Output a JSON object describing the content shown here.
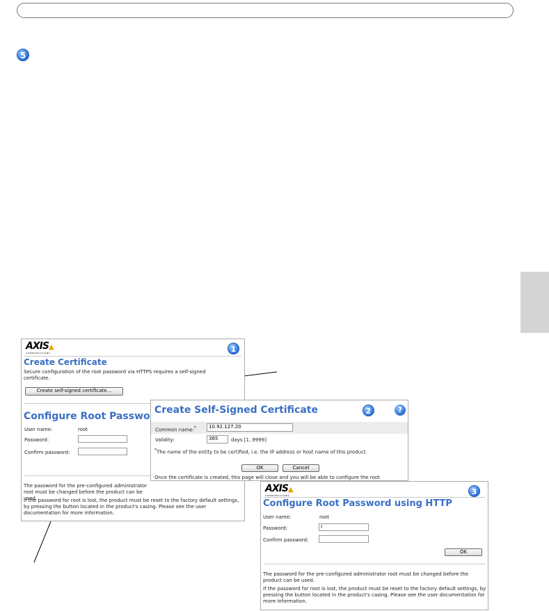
{
  "step_marker": "5",
  "window1": {
    "logo": "AXIS",
    "logo_sub": "COMMUNICATIONS",
    "badge": "1",
    "cert_title": "Create Certificate",
    "cert_text": "Secure configuration of the root password via HTTPS requires a self-signed certificate.",
    "cert_button": "Create self-signed certificate...",
    "root_title": "Configure Root Password",
    "user_label": "User name:",
    "user_value": "root",
    "password_label": "Password:",
    "confirm_label": "Confirm password:",
    "note1": "The password for the pre-configured administrator root must be changed before the product can be used.",
    "note2": "If the password for root is lost, the product must be reset to the factory default settings, by pressing the button located in the product's casing. Please see the user documentation for more information."
  },
  "window2": {
    "title": "Create Self-Signed Certificate",
    "badge": "2",
    "help": "?",
    "common_name_label": "Common name:",
    "common_name_mark": "*",
    "common_name_value": "10.92.127.20",
    "validity_label": "Validity:",
    "validity_value": "365",
    "validity_unit": "days [1..9999]",
    "footnote_mark": "*",
    "footnote": "The name of the entity to be certified, i.e. the IP address or host name of this product.",
    "ok": "OK",
    "cancel": "Cancel",
    "after_text": "Once the certificate is created, this page will close and you will be able to configure the root password via HTTPS."
  },
  "window3": {
    "logo": "AXIS",
    "logo_sub": "COMMUNICATIONS",
    "badge": "3",
    "title": "Configure Root Password using HTTP",
    "user_label": "User name:",
    "user_value": "root",
    "password_label": "Password:",
    "password_value": "I",
    "confirm_label": "Confirm password:",
    "ok": "OK",
    "note1": "The password for the pre-configured administrator root must be changed before the product can be used.",
    "note2": "If the password for root is lost, the product must be reset to the factory default settings, by pressing the button located in the product's casing. Please see the user documentation for more information."
  }
}
